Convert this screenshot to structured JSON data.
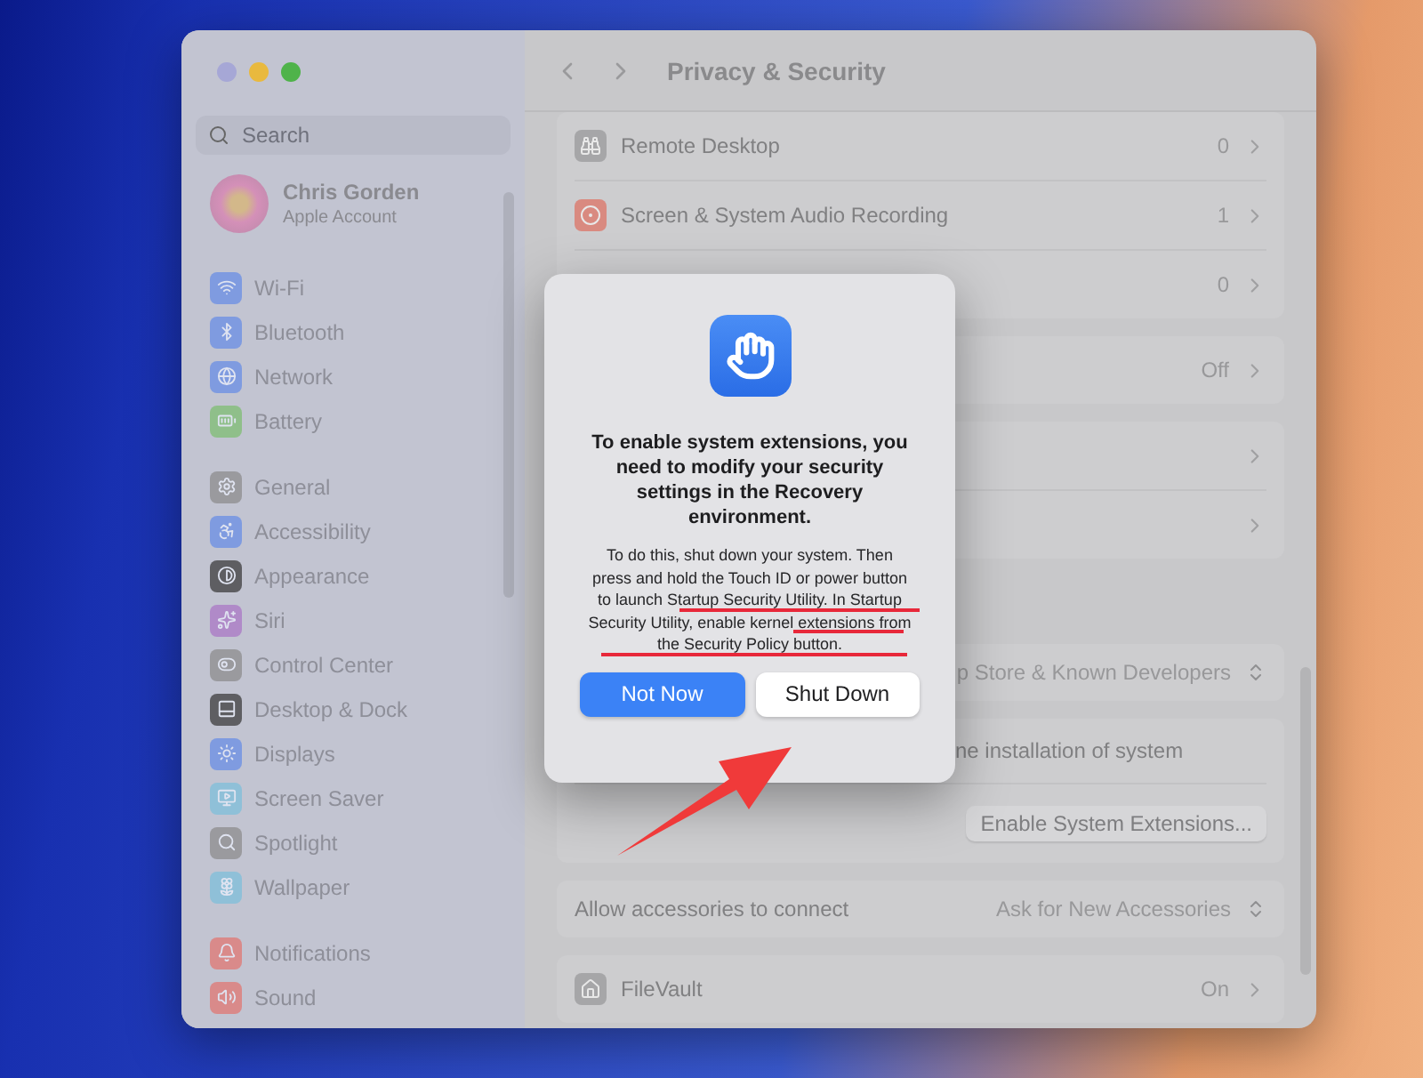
{
  "window": {
    "title": "Privacy & Security"
  },
  "sidebar": {
    "search": {
      "placeholder": "Search"
    },
    "account": {
      "name": "Chris Gorden",
      "subtitle": "Apple Account"
    },
    "groups": [
      [
        {
          "label": "Wi-Fi",
          "color": "#7f9be0"
        },
        {
          "label": "Bluetooth",
          "color": "#7f9be0"
        },
        {
          "label": "Network",
          "color": "#7f9be0"
        },
        {
          "label": "Battery",
          "color": "#8fbf8a"
        }
      ],
      [
        {
          "label": "General",
          "color": "#9a9a9e"
        },
        {
          "label": "Accessibility",
          "color": "#7f9be0"
        },
        {
          "label": "Appearance",
          "color": "#5e5e62"
        },
        {
          "label": "Siri",
          "color": "#b08ac8"
        },
        {
          "label": "Control Center",
          "color": "#9a9a9e"
        },
        {
          "label": "Desktop & Dock",
          "color": "#5e5e62"
        },
        {
          "label": "Displays",
          "color": "#7f9be0"
        },
        {
          "label": "Screen Saver",
          "color": "#8fc0d8"
        },
        {
          "label": "Spotlight",
          "color": "#9a9a9e"
        },
        {
          "label": "Wallpaper",
          "color": "#8fc0d8"
        }
      ],
      [
        {
          "label": "Notifications",
          "color": "#d98a8a"
        },
        {
          "label": "Sound",
          "color": "#d98a8a"
        }
      ]
    ]
  },
  "content": {
    "groups": [
      {
        "rows": [
          {
            "kind": "app",
            "label": "Remote Desktop",
            "value": "0"
          },
          {
            "kind": "app",
            "label": "Screen & System Audio Recording",
            "value": "1"
          },
          {
            "kind": "link",
            "value": "0"
          }
        ]
      },
      {
        "rows": [
          {
            "kind": "link",
            "value": "Off"
          }
        ]
      },
      {
        "rows": [
          {
            "kind": "link"
          },
          {
            "kind": "link"
          }
        ]
      },
      {
        "rows": [
          {
            "kind": "select",
            "value": "p Store & Known Developers"
          }
        ]
      },
      {
        "rows": [
          {
            "kind": "note",
            "label": "ne installation of system"
          },
          {
            "kind": "action",
            "button": "Enable System Extensions..."
          }
        ]
      },
      {
        "rows": [
          {
            "kind": "select",
            "label": "Allow accessories to connect",
            "value": "Ask for New Accessories"
          }
        ]
      },
      {
        "rows": [
          {
            "kind": "app",
            "label": "FileVault",
            "value": "On"
          }
        ]
      }
    ]
  },
  "dialog": {
    "title": "To enable system extensions, you need to modify your security settings in the Recovery environment.",
    "body": "To do this, shut down your system. Then press and hold the Touch ID or power button to launch Startup Security Utility. In Startup Security Utility, enable kernel extensions from the Security Policy button.",
    "buttons": [
      {
        "label": "Not Now",
        "default": true
      },
      {
        "label": "Shut Down",
        "default": false
      }
    ]
  }
}
